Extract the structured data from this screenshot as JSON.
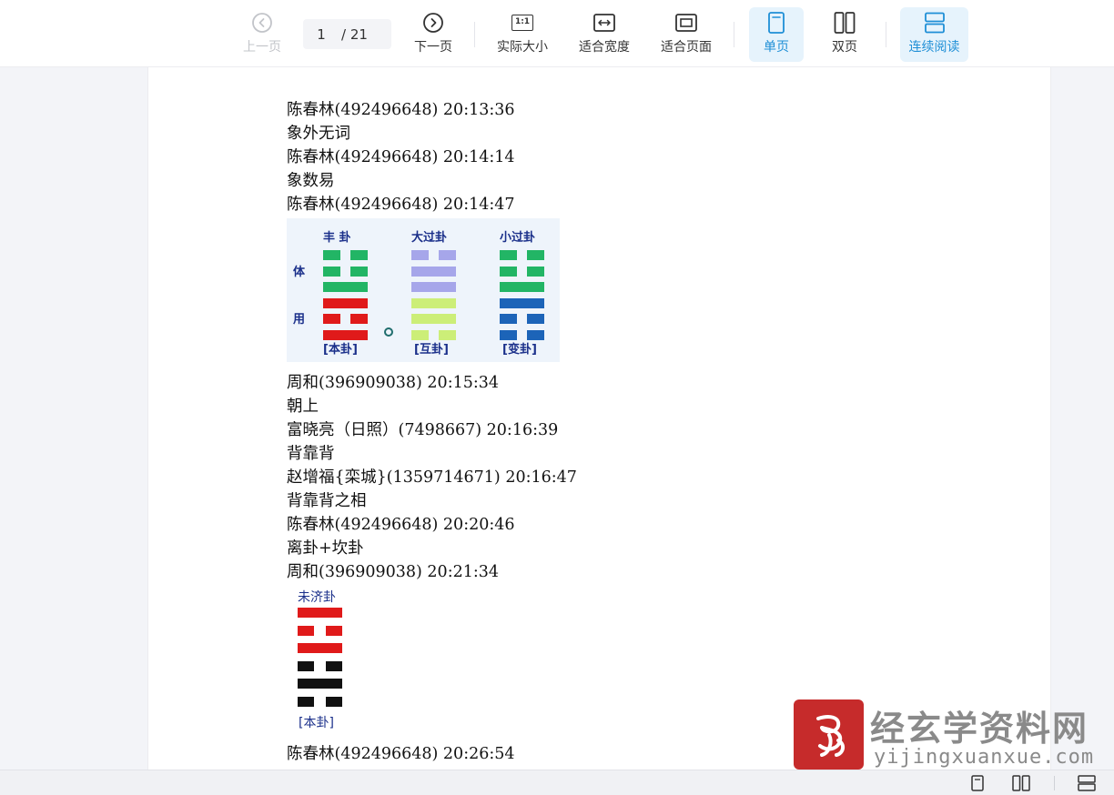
{
  "toolbar": {
    "prev_label": "上一页",
    "page_current": "1",
    "page_total": "/ 21",
    "next_label": "下一页",
    "actual_size_label": "实际大小",
    "actual_size_icon_text": "1:1",
    "fit_width_label": "适合宽度",
    "fit_page_label": "适合页面",
    "single_page_label": "单页",
    "double_page_label": "双页",
    "continuous_label": "连续阅读",
    "active_color": "#1f8fd6",
    "active_bg": "#e6f3fc"
  },
  "document": {
    "lines_top": [
      "陈春林(492496648) 20:13:36",
      "象外无词",
      "陈春林(492496648) 20:14:14",
      "象数易",
      "陈春林(492496648) 20:14:47"
    ],
    "figure1": {
      "titles": [
        "丰 卦",
        "大过卦",
        "小过卦"
      ],
      "bottoms": [
        "[本卦]",
        "[互卦]",
        "[变卦]"
      ],
      "side_top": "体",
      "side_bottom": "用",
      "colors": {
        "green": "#22b565",
        "red": "#e01a1a",
        "lavender": "#a6a6ea",
        "lime": "#ccee78",
        "blue": "#1c64b8",
        "label": "#1a2f8a"
      }
    },
    "lines_middle": [
      "周和(396909038) 20:15:34",
      "朝上",
      "富晓亮（日照）(7498667) 20:16:39",
      "背靠背",
      "赵增福{栾城}(1359714671) 20:16:47",
      "背靠背之相",
      "陈春林(492496648) 20:20:46",
      "离卦+坎卦",
      "周和(396909038) 20:21:34"
    ],
    "figure2": {
      "title": "未济卦",
      "bottom": "[本卦]",
      "colors": {
        "red": "#e01a1a",
        "black": "#111111"
      }
    },
    "line_cut": "陈春林(492496648) 20:26:54"
  },
  "watermark": {
    "title": "经玄学资料网",
    "url": "yijingxuanxue.com",
    "seal_color": "#c62b2b"
  }
}
